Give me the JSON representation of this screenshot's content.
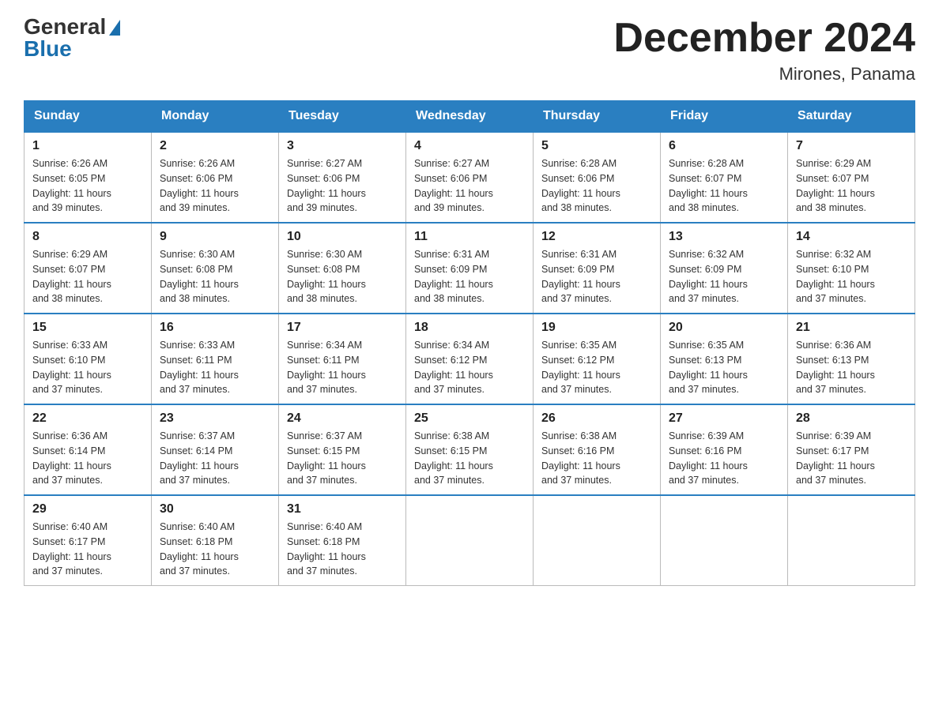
{
  "header": {
    "logo_general": "General",
    "logo_blue": "Blue",
    "month_title": "December 2024",
    "location": "Mirones, Panama"
  },
  "days_of_week": [
    "Sunday",
    "Monday",
    "Tuesday",
    "Wednesday",
    "Thursday",
    "Friday",
    "Saturday"
  ],
  "weeks": [
    [
      {
        "day": "1",
        "sunrise": "6:26 AM",
        "sunset": "6:05 PM",
        "daylight": "11 hours and 39 minutes."
      },
      {
        "day": "2",
        "sunrise": "6:26 AM",
        "sunset": "6:06 PM",
        "daylight": "11 hours and 39 minutes."
      },
      {
        "day": "3",
        "sunrise": "6:27 AM",
        "sunset": "6:06 PM",
        "daylight": "11 hours and 39 minutes."
      },
      {
        "day": "4",
        "sunrise": "6:27 AM",
        "sunset": "6:06 PM",
        "daylight": "11 hours and 39 minutes."
      },
      {
        "day": "5",
        "sunrise": "6:28 AM",
        "sunset": "6:06 PM",
        "daylight": "11 hours and 38 minutes."
      },
      {
        "day": "6",
        "sunrise": "6:28 AM",
        "sunset": "6:07 PM",
        "daylight": "11 hours and 38 minutes."
      },
      {
        "day": "7",
        "sunrise": "6:29 AM",
        "sunset": "6:07 PM",
        "daylight": "11 hours and 38 minutes."
      }
    ],
    [
      {
        "day": "8",
        "sunrise": "6:29 AM",
        "sunset": "6:07 PM",
        "daylight": "11 hours and 38 minutes."
      },
      {
        "day": "9",
        "sunrise": "6:30 AM",
        "sunset": "6:08 PM",
        "daylight": "11 hours and 38 minutes."
      },
      {
        "day": "10",
        "sunrise": "6:30 AM",
        "sunset": "6:08 PM",
        "daylight": "11 hours and 38 minutes."
      },
      {
        "day": "11",
        "sunrise": "6:31 AM",
        "sunset": "6:09 PM",
        "daylight": "11 hours and 38 minutes."
      },
      {
        "day": "12",
        "sunrise": "6:31 AM",
        "sunset": "6:09 PM",
        "daylight": "11 hours and 37 minutes."
      },
      {
        "day": "13",
        "sunrise": "6:32 AM",
        "sunset": "6:09 PM",
        "daylight": "11 hours and 37 minutes."
      },
      {
        "day": "14",
        "sunrise": "6:32 AM",
        "sunset": "6:10 PM",
        "daylight": "11 hours and 37 minutes."
      }
    ],
    [
      {
        "day": "15",
        "sunrise": "6:33 AM",
        "sunset": "6:10 PM",
        "daylight": "11 hours and 37 minutes."
      },
      {
        "day": "16",
        "sunrise": "6:33 AM",
        "sunset": "6:11 PM",
        "daylight": "11 hours and 37 minutes."
      },
      {
        "day": "17",
        "sunrise": "6:34 AM",
        "sunset": "6:11 PM",
        "daylight": "11 hours and 37 minutes."
      },
      {
        "day": "18",
        "sunrise": "6:34 AM",
        "sunset": "6:12 PM",
        "daylight": "11 hours and 37 minutes."
      },
      {
        "day": "19",
        "sunrise": "6:35 AM",
        "sunset": "6:12 PM",
        "daylight": "11 hours and 37 minutes."
      },
      {
        "day": "20",
        "sunrise": "6:35 AM",
        "sunset": "6:13 PM",
        "daylight": "11 hours and 37 minutes."
      },
      {
        "day": "21",
        "sunrise": "6:36 AM",
        "sunset": "6:13 PM",
        "daylight": "11 hours and 37 minutes."
      }
    ],
    [
      {
        "day": "22",
        "sunrise": "6:36 AM",
        "sunset": "6:14 PM",
        "daylight": "11 hours and 37 minutes."
      },
      {
        "day": "23",
        "sunrise": "6:37 AM",
        "sunset": "6:14 PM",
        "daylight": "11 hours and 37 minutes."
      },
      {
        "day": "24",
        "sunrise": "6:37 AM",
        "sunset": "6:15 PM",
        "daylight": "11 hours and 37 minutes."
      },
      {
        "day": "25",
        "sunrise": "6:38 AM",
        "sunset": "6:15 PM",
        "daylight": "11 hours and 37 minutes."
      },
      {
        "day": "26",
        "sunrise": "6:38 AM",
        "sunset": "6:16 PM",
        "daylight": "11 hours and 37 minutes."
      },
      {
        "day": "27",
        "sunrise": "6:39 AM",
        "sunset": "6:16 PM",
        "daylight": "11 hours and 37 minutes."
      },
      {
        "day": "28",
        "sunrise": "6:39 AM",
        "sunset": "6:17 PM",
        "daylight": "11 hours and 37 minutes."
      }
    ],
    [
      {
        "day": "29",
        "sunrise": "6:40 AM",
        "sunset": "6:17 PM",
        "daylight": "11 hours and 37 minutes."
      },
      {
        "day": "30",
        "sunrise": "6:40 AM",
        "sunset": "6:18 PM",
        "daylight": "11 hours and 37 minutes."
      },
      {
        "day": "31",
        "sunrise": "6:40 AM",
        "sunset": "6:18 PM",
        "daylight": "11 hours and 37 minutes."
      },
      null,
      null,
      null,
      null
    ]
  ],
  "labels": {
    "sunrise": "Sunrise:",
    "sunset": "Sunset:",
    "daylight": "Daylight:"
  }
}
